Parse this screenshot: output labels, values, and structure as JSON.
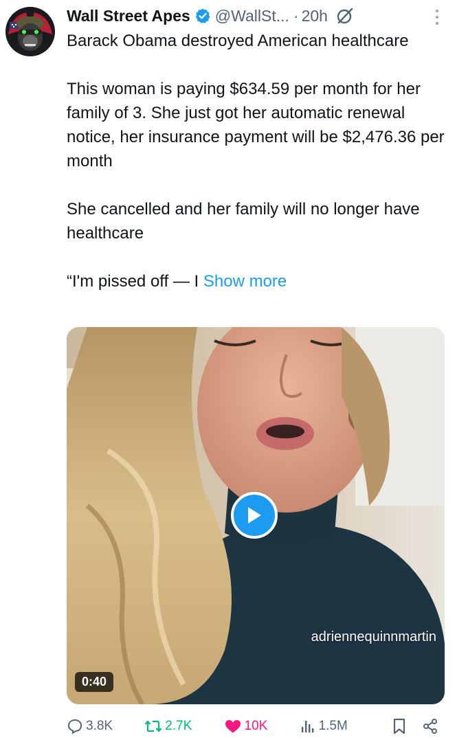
{
  "author": {
    "display_name": "Wall Street Apes",
    "handle": "@WallSt...",
    "dot": "·",
    "time": "20h",
    "verified": true
  },
  "tweet": {
    "paragraphs": [
      "Barack Obama destroyed American healthcare",
      "This woman is paying $634.59 per month for her family of 3. She just got her automatic renewal notice, her insurance payment will be $2,476.36 per month",
      "She cancelled and her family will no longer have healthcare"
    ],
    "last_line": "“I'm pissed off — I",
    "show_more": "Show more"
  },
  "media": {
    "watermark": "adriennequinnmartin",
    "duration": "0:40"
  },
  "stats": {
    "replies": "3.8K",
    "reposts": "2.7K",
    "likes": "10K",
    "views": "1.5M"
  },
  "colors": {
    "accent": "#1d9bf0",
    "repost": "#00ba7c",
    "like": "#f91880",
    "muted": "#536471"
  },
  "icons": {
    "verified": "verified-badge-icon",
    "grok": "grok-icon",
    "more": "more-vertical-icon",
    "reply": "reply-icon",
    "repost": "repost-icon",
    "like": "heart-icon",
    "views": "views-icon",
    "bookmark": "bookmark-icon",
    "share": "share-icon",
    "play": "play-icon"
  }
}
